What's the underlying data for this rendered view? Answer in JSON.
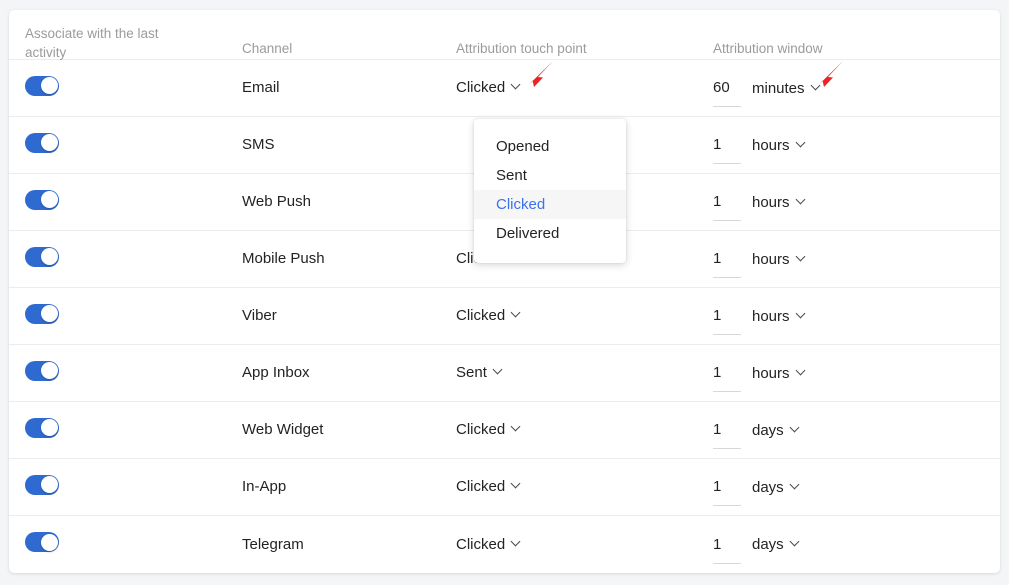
{
  "table": {
    "columns": [
      {
        "key": "toggle",
        "label": "Associate with the last activity",
        "label_line1": "Associate with the last",
        "label_line2": "activity"
      },
      {
        "key": "channel",
        "label": "Channel"
      },
      {
        "key": "touch",
        "label": "Attribution touch point"
      },
      {
        "key": "window",
        "label": "Attribution window"
      }
    ],
    "rows": [
      {
        "enabled": true,
        "channel": "Email",
        "touch_point": "Clicked",
        "window_value": "60",
        "window_unit": "minutes"
      },
      {
        "enabled": true,
        "channel": "SMS",
        "touch_point": "",
        "window_value": "1",
        "window_unit": "hours"
      },
      {
        "enabled": true,
        "channel": "Web Push",
        "touch_point": "",
        "window_value": "1",
        "window_unit": "hours"
      },
      {
        "enabled": true,
        "channel": "Mobile Push",
        "touch_point": "Clicked",
        "window_value": "1",
        "window_unit": "hours"
      },
      {
        "enabled": true,
        "channel": "Viber",
        "touch_point": "Clicked",
        "window_value": "1",
        "window_unit": "hours"
      },
      {
        "enabled": true,
        "channel": "App Inbox",
        "touch_point": "Sent",
        "window_value": "1",
        "window_unit": "hours"
      },
      {
        "enabled": true,
        "channel": "Web Widget",
        "touch_point": "Clicked",
        "window_value": "1",
        "window_unit": "days"
      },
      {
        "enabled": true,
        "channel": "In-App",
        "touch_point": "Clicked",
        "window_value": "1",
        "window_unit": "days"
      },
      {
        "enabled": true,
        "channel": "Telegram",
        "touch_point": "Clicked",
        "window_value": "1",
        "window_unit": "days"
      }
    ]
  },
  "touch_point_dropdown": {
    "open": true,
    "options": [
      {
        "label": "Opened",
        "selected": false
      },
      {
        "label": "Sent",
        "selected": false
      },
      {
        "label": "Clicked",
        "selected": true
      },
      {
        "label": "Delivered",
        "selected": false
      }
    ]
  },
  "annotations": [
    {
      "name": "arrow-touch-point-dropdown",
      "color": "#ee2222"
    },
    {
      "name": "arrow-attribution-window-unit-dropdown",
      "color": "#ee2222"
    }
  ],
  "colors": {
    "page_background": "#f4f5f6",
    "card_background": "#ffffff",
    "toggle_on": "#2f6ad0",
    "header_text": "#9b9b9b",
    "body_text": "#232323",
    "selected_option": "#3b73e8",
    "selected_option_bg": "#f6f6f6",
    "row_divider": "#ececec",
    "annotation_red": "#ee2222"
  }
}
